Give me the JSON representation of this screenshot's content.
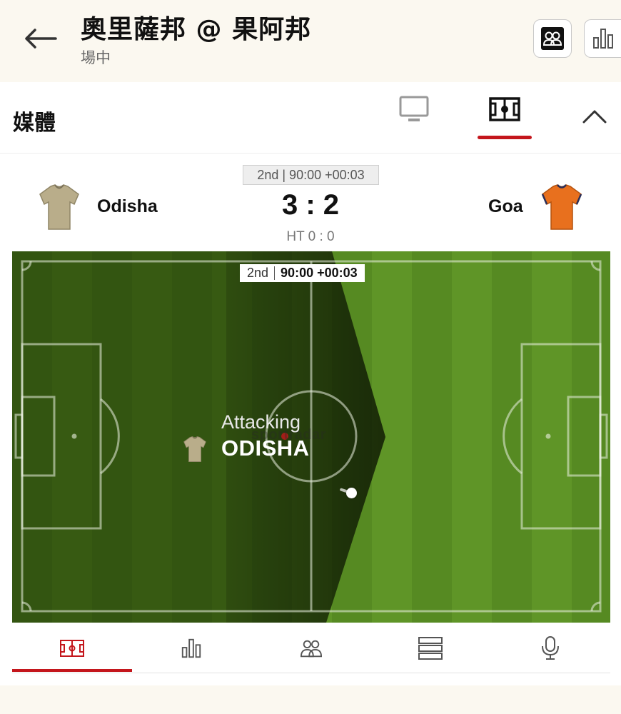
{
  "header": {
    "title": "奧里薩邦 @ 果阿邦",
    "status": "場中"
  },
  "media": {
    "label": "媒體"
  },
  "match": {
    "period_chip": "2nd | 90:00 +00:03",
    "home_team": "Odisha",
    "away_team": "Goa",
    "score": "3 : 2",
    "halftime": "HT 0 : 0",
    "home_kit_color": "#b9ad8a",
    "away_kit_color": "#e8701e"
  },
  "pitch": {
    "clock_period": "2nd",
    "clock_time": "90:00 +00:03",
    "attacking_label": "Attacking",
    "attacking_team": "ODISHA",
    "watermark": "sportradar"
  },
  "colors": {
    "accent": "#c4161c",
    "pitch_dark": "#2f4d12",
    "pitch_light": "#5f9527"
  },
  "bottom_tabs": [
    {
      "icon": "pitch-icon",
      "active": true
    },
    {
      "icon": "stats-icon",
      "active": false
    },
    {
      "icon": "lineups-icon",
      "active": false
    },
    {
      "icon": "list-icon",
      "active": false
    },
    {
      "icon": "microphone-icon",
      "active": false
    }
  ]
}
